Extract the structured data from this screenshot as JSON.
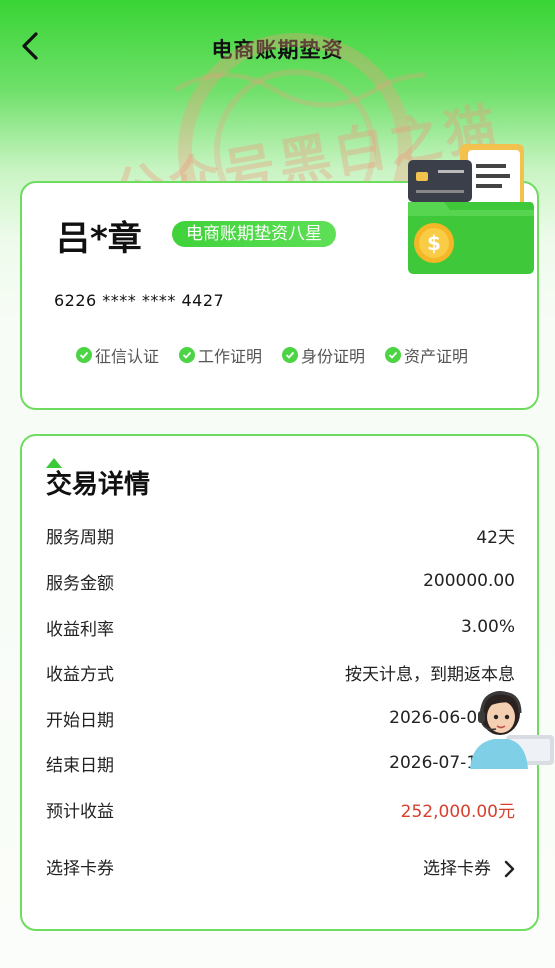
{
  "header": {
    "title": "电商账期垫资"
  },
  "profile": {
    "name": "吕*章",
    "level": "电商账期垫资八星",
    "card_number": "6226 **** **** 4427",
    "certifications": [
      {
        "label": "征信认证"
      },
      {
        "label": "工作证明"
      },
      {
        "label": "身份证明"
      },
      {
        "label": "资产证明"
      }
    ]
  },
  "details": {
    "title": "交易详情",
    "rows": [
      {
        "label": "服务周期",
        "value": "42天"
      },
      {
        "label": "服务金额",
        "value": "200000.00"
      },
      {
        "label": "收益利率",
        "value": "3.00%"
      },
      {
        "label": "收益方式",
        "value": "按天计息，到期返本息"
      },
      {
        "label": "开始日期",
        "value": "2026-06-06 22"
      },
      {
        "label": "结束日期",
        "value": "2026-07-18 22"
      },
      {
        "label": "预计收益",
        "value": "252,000.00元"
      },
      {
        "label": "选择卡券",
        "value": "选择卡券"
      }
    ]
  },
  "watermark": {
    "text": "公众号黑白之猫"
  },
  "colors": {
    "brand_green": "#3fd23a",
    "highlight_red": "#d8402e"
  },
  "icons": {
    "back": "chevron-left-icon",
    "check": "check-circle-icon",
    "next": "chevron-right-icon",
    "wallet": "wallet-card-icon",
    "support": "customer-service-avatar"
  }
}
